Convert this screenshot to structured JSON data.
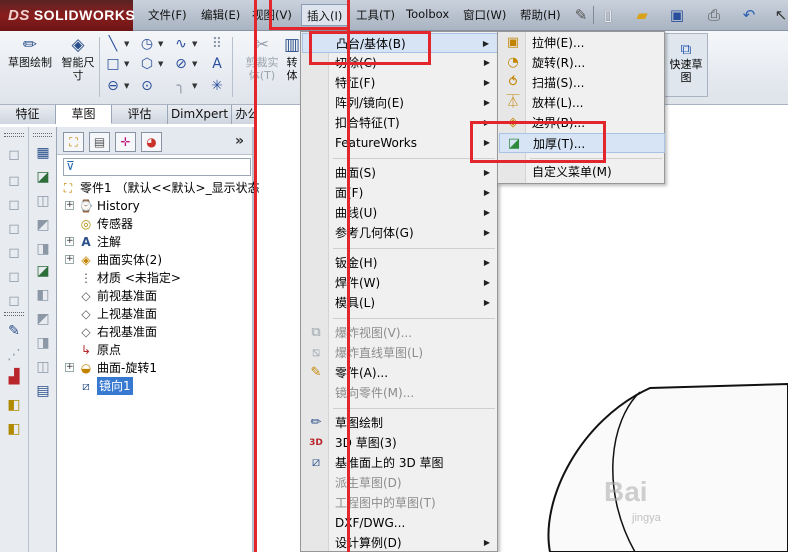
{
  "app": {
    "logo_text": "SOLIDWORKS",
    "logo_prefix": "DS"
  },
  "menubar": {
    "items": [
      "文件(F)",
      "编辑(E)",
      "视图(V)",
      "插入(I)",
      "工具(T)",
      "Toolbox",
      "窗口(W)",
      "帮助(H)"
    ],
    "active": "插入(I)"
  },
  "command_manager": {
    "sketch": "草图绘制",
    "smart_dim_line1": "智能尺",
    "smart_dim_line2": "寸",
    "cut_entities_line1": "剪裁实",
    "cut_entities_line2": "体(T)",
    "convert_partial": "转",
    "convert_partial2": "体",
    "quick_snap_line1": "快速草",
    "quick_snap_line2": "图"
  },
  "tabs": [
    "特征",
    "草图",
    "评估",
    "DimXpert",
    "办公室产品"
  ],
  "active_tab": "草图",
  "feature_tree": {
    "root": "零件1 （默认<<默认>_显示状态",
    "items": [
      {
        "label": "History",
        "icon": "history-icon",
        "expandable": true
      },
      {
        "label": "传感器",
        "icon": "sensor-icon",
        "expandable": false
      },
      {
        "label": "注解",
        "icon": "annotation-icon",
        "expandable": true
      },
      {
        "label": "曲面实体(2)",
        "icon": "surface-body-icon",
        "expandable": true
      },
      {
        "label": "材质 <未指定>",
        "icon": "material-icon",
        "expandable": false
      },
      {
        "label": "前视基准面",
        "icon": "plane-icon",
        "expandable": false
      },
      {
        "label": "上视基准面",
        "icon": "plane-icon",
        "expandable": false
      },
      {
        "label": "右视基准面",
        "icon": "plane-icon",
        "expandable": false
      },
      {
        "label": "原点",
        "icon": "origin-icon",
        "expandable": false
      },
      {
        "label": "曲面-旋转1",
        "icon": "surface-revolve-icon",
        "expandable": true
      },
      {
        "label": "镜向1",
        "icon": "mirror-icon",
        "expandable": false,
        "selected": true
      }
    ]
  },
  "insert_menu": {
    "groups": [
      [
        {
          "label": "凸台/基体(B)",
          "submenu": true,
          "highlighted": true
        },
        {
          "label": "切除(C)",
          "submenu": true
        },
        {
          "label": "特征(F)",
          "submenu": true
        },
        {
          "label": "阵列/镜向(E)",
          "submenu": true
        },
        {
          "label": "扣合特征(T)",
          "submenu": true
        },
        {
          "label": "FeatureWorks",
          "submenu": true
        }
      ],
      [
        {
          "label": "曲面(S)",
          "submenu": true
        },
        {
          "label": "面(F)",
          "submenu": true
        },
        {
          "label": "曲线(U)",
          "submenu": true
        },
        {
          "label": "参考几何体(G)",
          "submenu": true
        }
      ],
      [
        {
          "label": "钣金(H)",
          "submenu": true
        },
        {
          "label": "焊件(W)",
          "submenu": true
        },
        {
          "label": "模具(L)",
          "submenu": true
        }
      ],
      [
        {
          "label": "爆炸视图(V)...",
          "disabled": true,
          "icon": "explode-view-icon"
        },
        {
          "label": "爆炸直线草图(L)",
          "disabled": true,
          "icon": "explode-line-icon"
        },
        {
          "label": "零件(A)...",
          "icon": "part-icon"
        },
        {
          "label": "镜向零件(M)...",
          "disabled": true
        }
      ],
      [
        {
          "label": "草图绘制",
          "icon": "sketch-icon"
        },
        {
          "label": "3D 草图(3)",
          "icon": "3d-sketch-icon"
        },
        {
          "label": "基准面上的 3D 草图",
          "icon": "3d-sketch-plane-icon"
        },
        {
          "label": "派生草图(D)",
          "disabled": true
        },
        {
          "label": "工程图中的草图(T)",
          "disabled": true
        },
        {
          "label": "DXF/DWG..."
        },
        {
          "label": "设计算例(D)",
          "submenu": true
        }
      ]
    ]
  },
  "boss_submenu": {
    "items": [
      {
        "label": "拉伸(E)...",
        "icon": "extrude-icon"
      },
      {
        "label": "旋转(R)...",
        "icon": "revolve-icon"
      },
      {
        "label": "扫描(S)...",
        "icon": "sweep-icon"
      },
      {
        "label": "放样(L)...",
        "icon": "loft-icon"
      },
      {
        "label": "边界(B)...",
        "icon": "boundary-icon"
      },
      {
        "label": "加厚(T)...",
        "icon": "thicken-icon",
        "highlighted": true
      },
      {
        "label": "自定义菜单(M)"
      }
    ]
  },
  "watermark": {
    "main": "Bai",
    "sub": "jingya"
  },
  "colors": {
    "highlight_box": "#e3262c",
    "selection": "#3778d1",
    "menu_highlight": "#d6e4f5"
  }
}
